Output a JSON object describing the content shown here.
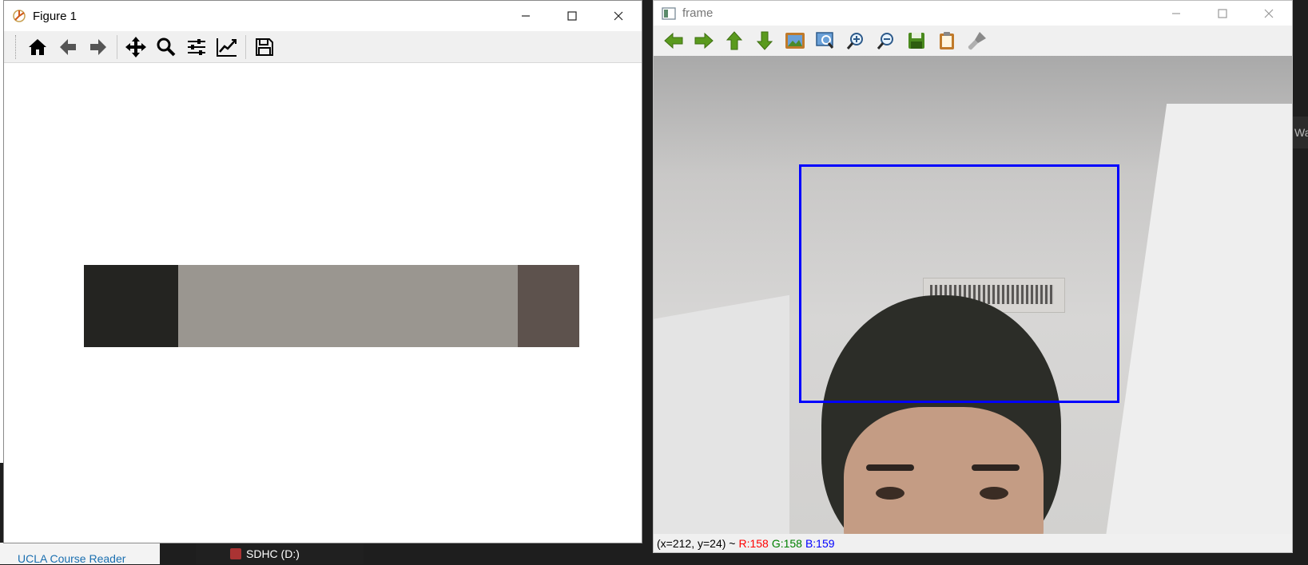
{
  "background": {
    "course_reader_link": "UCLA Course Reader",
    "drive_label": "SDHC (D:)",
    "right_partial_text": "Wa"
  },
  "figure_window": {
    "title": "Figure 1",
    "toolbar": [
      "home-icon",
      "back-icon",
      "forward-icon",
      "pan-icon",
      "zoom-icon",
      "configure-subplots-icon",
      "edit-axis-icon",
      "save-icon"
    ],
    "color_bar": [
      {
        "color": "#242421",
        "fraction": 0.19
      },
      {
        "color": "#9a9690",
        "fraction": 0.685
      },
      {
        "color": "#5d524d",
        "fraction": 0.125
      }
    ]
  },
  "frame_window": {
    "title": "frame",
    "toolbar": [
      "pan-left-icon",
      "pan-right-icon",
      "pan-up-icon",
      "pan-down-icon",
      "zoom-fit-icon",
      "zoom-original-icon",
      "zoom-in-icon",
      "zoom-out-icon",
      "save-image-icon",
      "copy-clipboard-icon",
      "properties-icon"
    ],
    "box_color": "#0000ff",
    "status": {
      "coords": "(x=212, y=24) ~",
      "r": "R:158",
      "g": "G:158",
      "b": "B:159"
    }
  }
}
